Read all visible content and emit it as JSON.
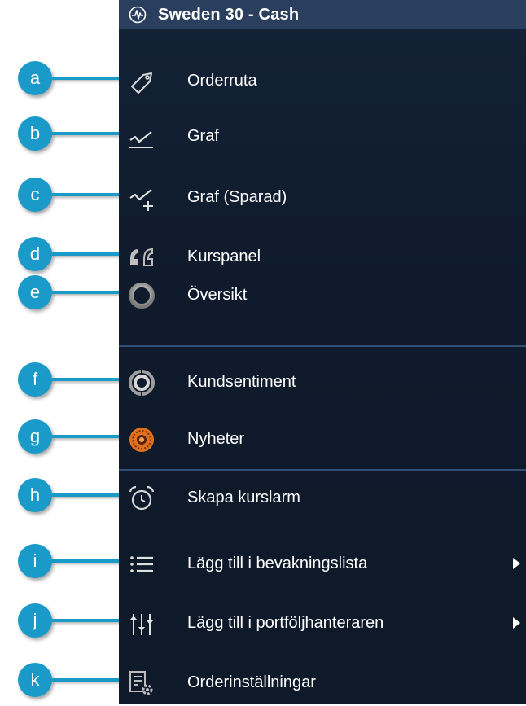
{
  "header": {
    "title": "Sweden 30 - Cash",
    "icon": "pulse-circle-icon"
  },
  "items": [
    {
      "callout": "a",
      "label": "Orderruta",
      "icon": "tag-icon",
      "has_submenu": false
    },
    {
      "callout": "b",
      "label": "Graf",
      "icon": "chart-line-icon",
      "has_submenu": false
    },
    {
      "callout": "c",
      "label": "Graf (Sparad)",
      "icon": "chart-line-plus-icon",
      "has_submenu": false
    },
    {
      "callout": "d",
      "label": "Kurspanel",
      "icon": "quote-icon",
      "has_submenu": false
    },
    {
      "callout": "e",
      "label": "Översikt",
      "icon": "ring-icon",
      "has_submenu": false
    },
    {
      "callout": "f",
      "label": "Kundsentiment",
      "icon": "sentiment-ring-icon",
      "has_submenu": false
    },
    {
      "callout": "g",
      "label": "Nyheter",
      "icon": "news-burst-icon",
      "has_submenu": false
    },
    {
      "callout": "h",
      "label": "Skapa kurslarm",
      "icon": "alarm-clock-icon",
      "has_submenu": false
    },
    {
      "callout": "i",
      "label": "Lägg till i bevakningslista",
      "icon": "list-icon",
      "has_submenu": true
    },
    {
      "callout": "j",
      "label": "Lägg till i portföljhanteraren",
      "icon": "sliders-icon",
      "has_submenu": true
    },
    {
      "callout": "k",
      "label": "Orderinställningar",
      "icon": "settings-document-icon",
      "has_submenu": false
    }
  ],
  "colors": {
    "menu_bg": "#0f1a2a",
    "header_bg": "#2a3f5d",
    "callout": "#1a9ac9",
    "divider": "#2f4f73",
    "news_orange": "#e0701f"
  }
}
